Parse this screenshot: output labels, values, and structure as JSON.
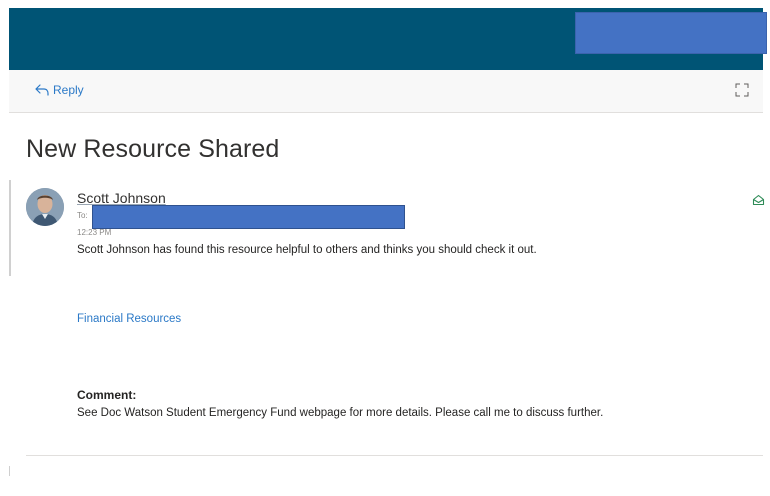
{
  "toolbar": {
    "reply_label": "Reply",
    "reply_icon": "reply-icon",
    "expand_icon": "expand-icon"
  },
  "message": {
    "subject": "New Resource Shared",
    "sender": "Scott Johnson",
    "to_label": "To:",
    "time": "12:23 PM",
    "body": "Scott Johnson has found this resource helpful to others and thinks you should check it out.",
    "link_text": "Financial Resources",
    "comment_label": "Comment:",
    "comment": "See Doc Watson Student Emergency Fund webpage for more details. Please call me to discuss further."
  },
  "colors": {
    "header": "#005475",
    "redaction": "#4472c4",
    "link": "#2b79c7",
    "read_icon": "#2e8b57"
  }
}
